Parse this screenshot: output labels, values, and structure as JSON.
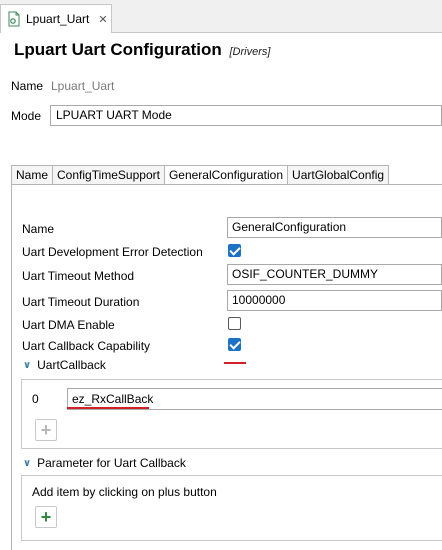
{
  "editor_tab": {
    "label": "Lpuart_Uart",
    "close": "✕"
  },
  "page": {
    "title": "Lpuart Uart Configuration",
    "subtitle": "[Drivers]"
  },
  "header_fields": {
    "name_label": "Name",
    "name_value": "Lpuart_Uart",
    "mode_label": "Mode",
    "mode_value": "LPUART UART Mode"
  },
  "tabs": [
    {
      "label": "Name"
    },
    {
      "label": "ConfigTimeSupport"
    },
    {
      "label": "GeneralConfiguration",
      "active": true
    },
    {
      "label": "UartGlobalConfig"
    }
  ],
  "fields": {
    "name": {
      "label": "Name",
      "value": "GeneralConfiguration"
    },
    "dev_error": {
      "label": "Uart Development Error Detection",
      "checked": true
    },
    "timeout_method": {
      "label": "Uart Timeout Method",
      "value": "OSIF_COUNTER_DUMMY"
    },
    "timeout_duration": {
      "label": "Uart Timeout Duration",
      "value": "10000000"
    },
    "dma_enable": {
      "label": "Uart DMA Enable",
      "checked": false
    },
    "callback_capability": {
      "label": "Uart Callback Capability",
      "checked": true
    }
  },
  "uart_callback": {
    "heading": "UartCallback",
    "items": [
      {
        "index": "0",
        "value": "ez_RxCallBack"
      }
    ]
  },
  "param_callback": {
    "heading": "Parameter for Uart Callback",
    "hint": "Add item by clicking on plus button"
  },
  "icons": {
    "chevron": "chevron-down-icon",
    "plus": "plus-icon",
    "file": "file-icon"
  },
  "colors": {
    "accent": "#1a73c9",
    "annotation_red": "#d2202a",
    "plus_active": "#2e8b3e",
    "plus_disabled": "#b8b8b8"
  }
}
